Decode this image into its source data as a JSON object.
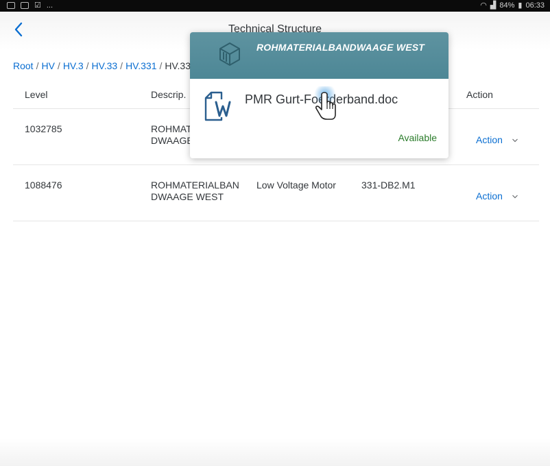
{
  "status_bar": {
    "left_more": "...",
    "battery": "84%",
    "time": "06:33"
  },
  "app_bar": {
    "title": "Technical Structure"
  },
  "breadcrumb": {
    "items": [
      "Root",
      "HV",
      "HV.3",
      "HV.33",
      "HV.331"
    ],
    "current": "HV.33"
  },
  "table": {
    "headers": {
      "level": "Level",
      "description": "Descrip.",
      "action": "Action"
    },
    "rows": [
      {
        "level": "1032785",
        "description": "ROHMATI\nDWAAGE",
        "type": "",
        "tech": "",
        "action": "Action"
      },
      {
        "level": "1088476",
        "description": "ROHMATERIALBAN\nDWAAGE WEST",
        "type": "Low Voltage Motor",
        "tech": "331-DB2.M1",
        "action": "Action"
      }
    ]
  },
  "popover": {
    "title": "ROHMATERIALBANDWAAGE WEST",
    "document": {
      "name": "PMR Gurt-Foerderband.doc",
      "status": "Available",
      "icon": "word-document-icon"
    },
    "header_icon": "object-cube-icon"
  },
  "colors": {
    "link": "#0a6ed1",
    "header": "#5e93a0",
    "status_ok": "#2b7c2b"
  }
}
